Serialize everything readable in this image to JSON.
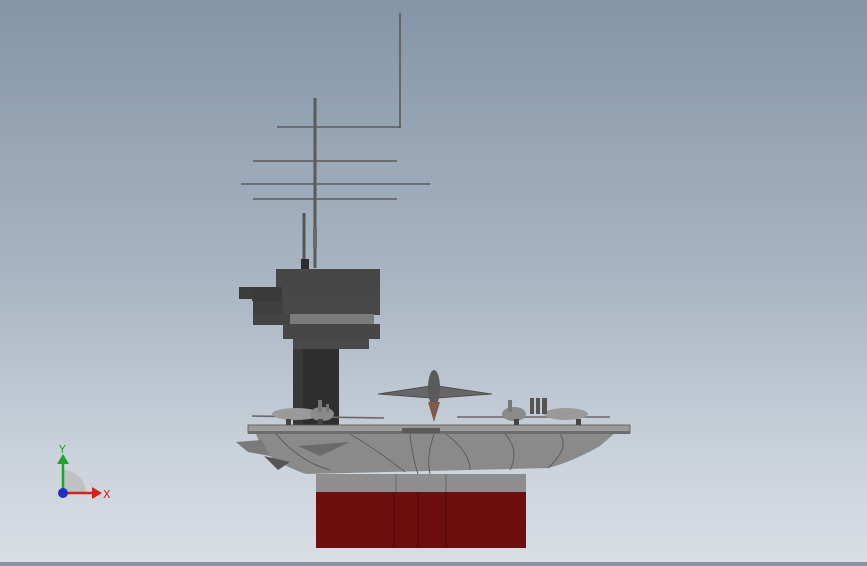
{
  "triad": {
    "x_label": "X",
    "y_label": "Y"
  },
  "colors": {
    "hull": "#8a8a8a",
    "hull_dark": "#5d5d5d",
    "island": "#474747",
    "island_dark": "#2e2e2e",
    "hull_bottom": "#6e0f0f",
    "deck": "#9b9b9b",
    "mast": "#5a5a5a",
    "axis_x": "#d32020",
    "axis_y": "#22a030",
    "axis_z": "#2030c0"
  },
  "icons": [
    "coordinate-triad-icon"
  ]
}
